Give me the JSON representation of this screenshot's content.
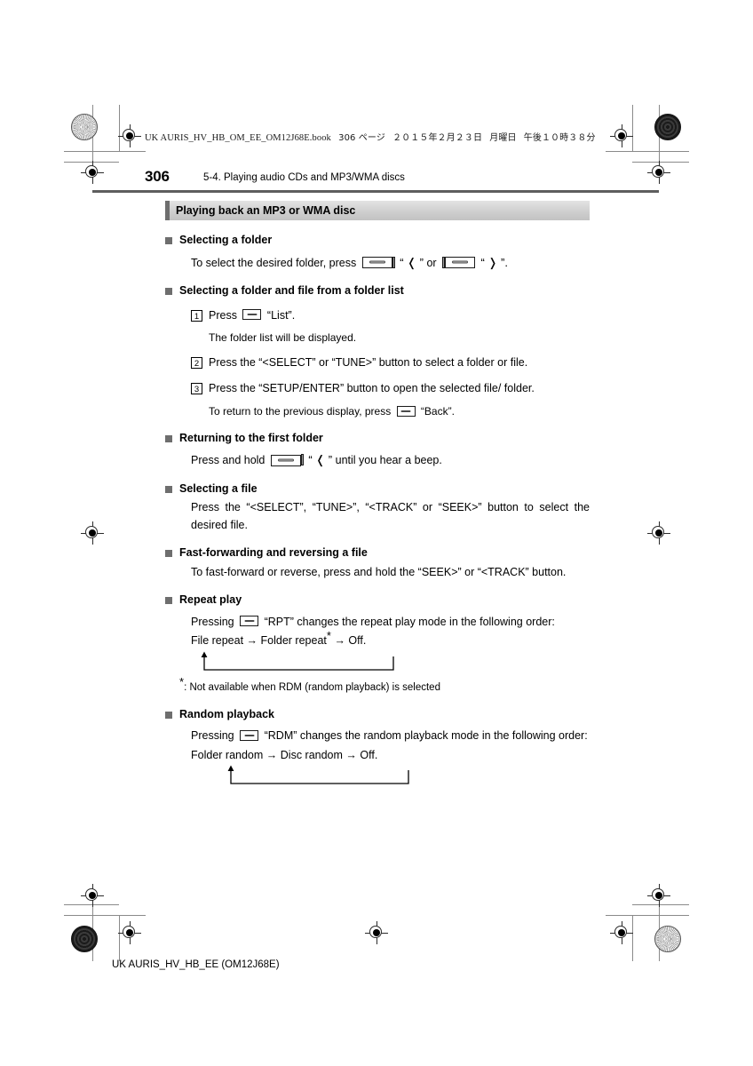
{
  "print_header": {
    "file": "UK AURIS_HV_HB_OM_EE_OM12J68E.book",
    "page_label": "306 ページ",
    "date": "２０１５年２月２３日",
    "weekday": "月曜日",
    "time": "午後１０時３８分"
  },
  "folio": "306",
  "running_head": "5-4. Playing audio CDs and MP3/WMA discs",
  "section": {
    "title": "Playing back an MP3 or WMA disc"
  },
  "blocks": {
    "selecting_folder": {
      "heading": "Selecting a folder",
      "text_before": "To select the desired folder, press",
      "quote_left": "“ ❬ ”",
      "or_word": "or",
      "quote_right": "“ ❭ ”."
    },
    "folder_list": {
      "heading": "Selecting a folder and file from a folder list",
      "step1_num": "1",
      "step1_before": "Press",
      "step1_after": "“List”.",
      "step1_note": "The folder list will be displayed.",
      "step2_num": "2",
      "step2_text": "Press the “<SELECT” or “TUNE>” button to select a folder or file.",
      "step3_num": "3",
      "step3_text": "Press the “SETUP/ENTER” button to open the selected file/ folder.",
      "step3_note_before": "To return to the previous display, press",
      "step3_note_after": "“Back”."
    },
    "first_folder": {
      "heading": "Returning to the first folder",
      "text_before": "Press and hold",
      "quote": "“ ❬ ”",
      "text_after": "until you hear a beep."
    },
    "selecting_file": {
      "heading": "Selecting a file",
      "text": "Press the “<SELECT”, “TUNE>”, “<TRACK” or “SEEK>” button to select the desired file."
    },
    "fast_forward": {
      "heading": "Fast-forwarding and reversing a file",
      "text": "To fast-forward or reverse, press and hold the “SEEK>” or “<TRACK” button."
    },
    "repeat_play": {
      "heading": "Repeat play",
      "text_before": "Pressing",
      "text_after": "“RPT” changes the repeat play mode in the following order:",
      "order_1": "File repeat",
      "order_2": "Folder repeat",
      "order_3": "Off.",
      "star": "*",
      "arrow": "→"
    },
    "footnote": {
      "star": "*",
      "text": ": Not available when RDM (random playback) is selected"
    },
    "random_playback": {
      "heading": "Random playback",
      "text_before": "Pressing",
      "text_after": "“RDM” changes the random playback mode in the following order:",
      "order_1": "Folder random",
      "order_2": "Disc random",
      "order_3": "Off.",
      "arrow": "→"
    }
  },
  "footer": "UK AURIS_HV_HB_EE (OM12J68E)"
}
